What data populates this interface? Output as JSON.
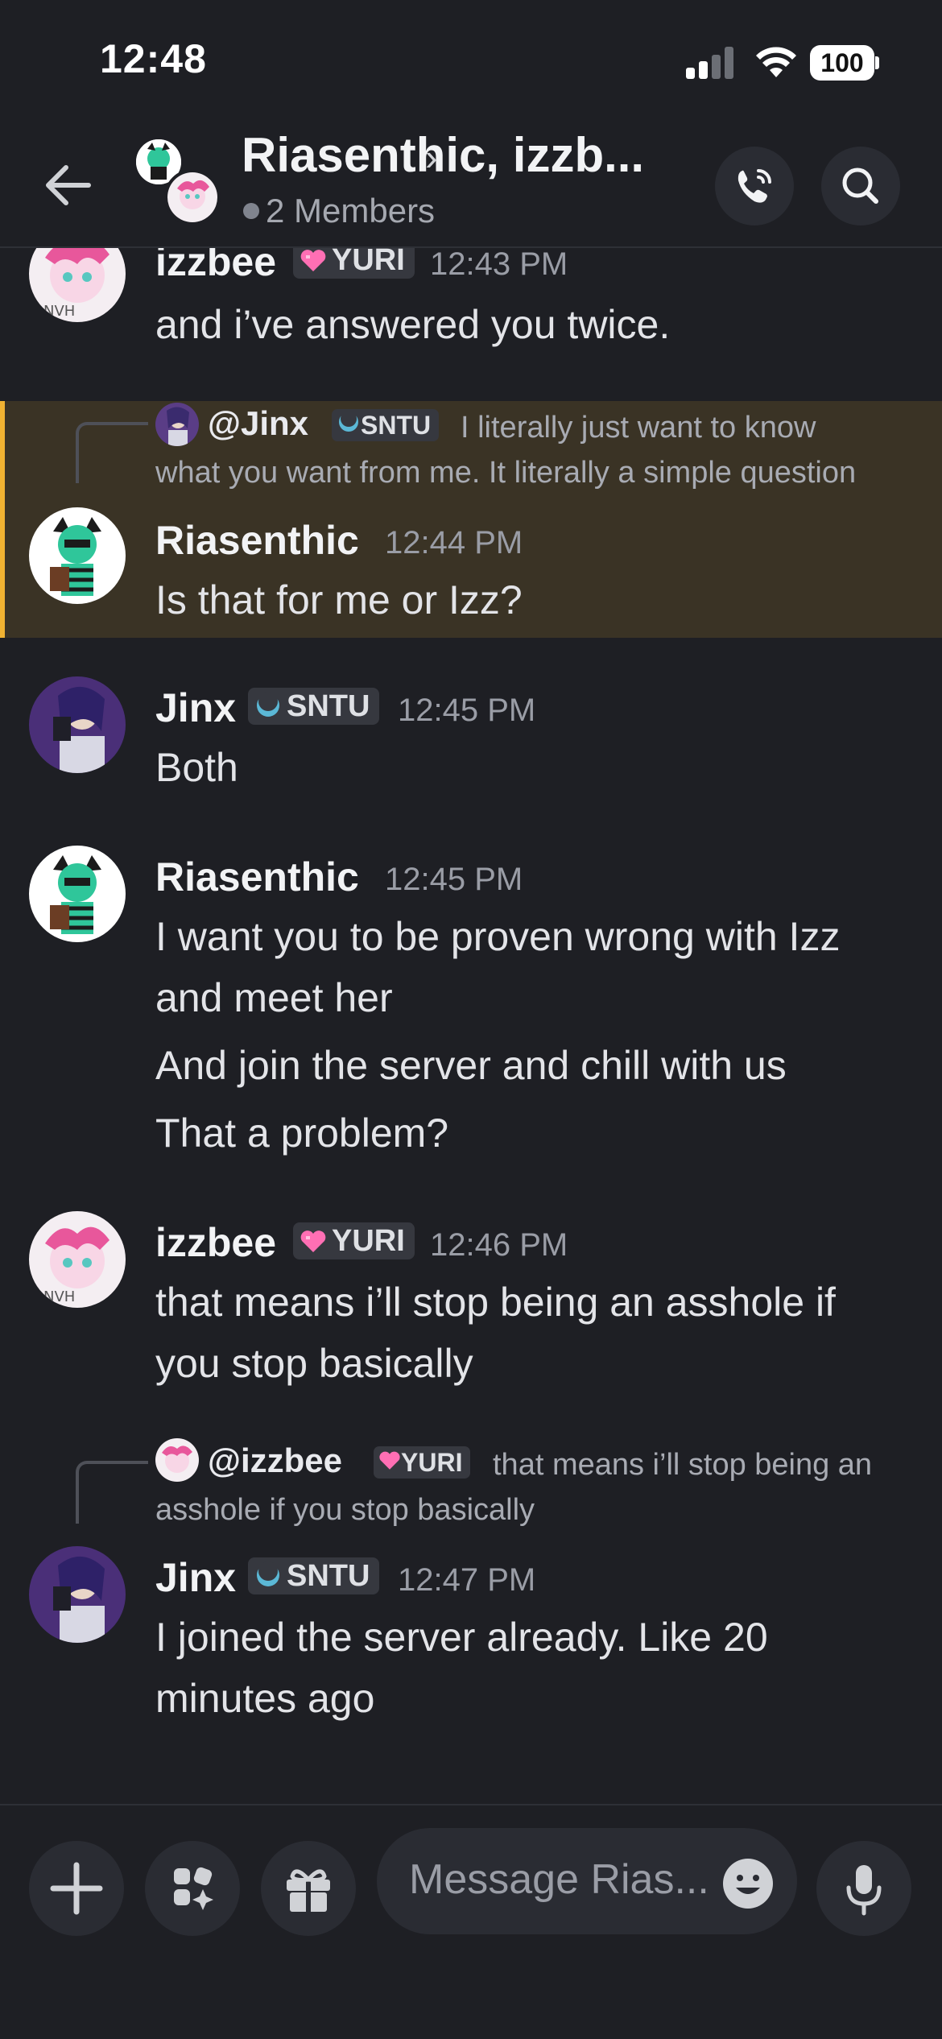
{
  "status_bar": {
    "time": "12:48",
    "battery": "100"
  },
  "header": {
    "title": "Riasenthic, izzb...",
    "members": "2 Members"
  },
  "messages": [
    {
      "author": "izzbee",
      "tag": "YURI",
      "time": "12:43 PM",
      "lines": [
        "and i’ve answered you twice."
      ]
    },
    {
      "reply": {
        "author": "@Jinx",
        "tag": "SNTU",
        "line1": "I literally just want to know",
        "line2": "what you want from me. It literally a simple question"
      },
      "author": "Riasenthic",
      "time": "12:44 PM",
      "lines": [
        "Is that for me or Izz?"
      ]
    },
    {
      "author": "Jinx",
      "tag": "SNTU",
      "time": "12:45 PM",
      "lines": [
        "Both"
      ]
    },
    {
      "author": "Riasenthic",
      "time": "12:45 PM",
      "lines": [
        "I want you to be proven wrong with Izz",
        "and meet her",
        "And join the server and chill with us",
        "That a problem?"
      ]
    },
    {
      "author": "izzbee",
      "tag": "YURI",
      "time": "12:46 PM",
      "lines": [
        "that means i’ll stop being an asshole if",
        "you stop basically"
      ]
    },
    {
      "reply": {
        "author": "@izzbee",
        "tag": "YURI",
        "line1": "that means i’ll stop being an",
        "line2": "asshole if you stop basically"
      },
      "author": "Jinx",
      "tag": "SNTU",
      "time": "12:47 PM",
      "lines": [
        "I joined the server already. Like 20",
        "minutes ago"
      ]
    }
  ],
  "composer": {
    "placeholder": "Message Rias..."
  },
  "colors": {
    "background": "#1e1f24",
    "highlight": "#3a3325",
    "highlight_bar": "#f0b232",
    "tag_bg": "#36383f"
  },
  "icons": [
    "back-arrow-icon",
    "phone-call-icon",
    "search-icon",
    "plus-icon",
    "apps-icon",
    "gift-icon",
    "emoji-icon",
    "microphone-icon"
  ]
}
